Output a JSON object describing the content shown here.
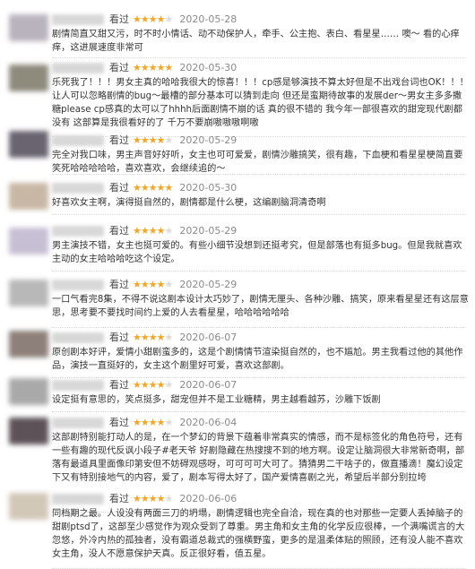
{
  "status_label": "看过",
  "reviews": [
    {
      "rating": 4,
      "time": "2020-05-28",
      "avatar_color": "#b9b3bd",
      "text": "剧情简直又甜又污，时不时小情话、动不动保护人，牵手、公主抱、表白、看星星…… 噢～ 看的心痒痒，这进展速度非常可"
    },
    {
      "rating": 5,
      "time": "2020-05-30",
      "avatar_color": "#8e8a7c",
      "text": "乐死我了！！！男女主真的哈哈我很大的惊喜！！！cp感是够演技不算太好但是不出戏台词也OK！！！让人可以忽略剧情的bug～最槽的部分基本可以猜到走向 但还是蛮期待故事的发展der～男女主多多撒糖please cp感真的太可以了hhhh后面剧情不崩的话 真的很不错的 我今年一部很喜欢的甜宠现代剧都没有 这部算是我很看好的了 千万不要崩嗷嗷嗷啊嗷"
    },
    {
      "rating": 4,
      "time": "2020-05-29",
      "avatar_color": "#6a6470",
      "text": "完全对我口味，男主声音好好听，女主也可可爱爱，剧情沙雕搞笑，很有趣，下血梗和看星星梗简直要笑死哈哈哈哈哈，喜欢喜欢，会继续追的～"
    },
    {
      "rating": 5,
      "time": "2020-05-30",
      "avatar_color": "#c8b7a5",
      "text": "好喜欢女主啊，演得挺自然的，剧情都是什么梗，这编剧脑洞清奇啊"
    },
    {
      "rating": 4,
      "time": "2020-05-29",
      "avatar_color": "#c7bfd3",
      "text": "男主演技不错，女主也挺可爱的。有些小细节没想到还挺考究，但是部落也有挺多bug。但是我就喜欢主动的女主哈哈哈吃这个设定。"
    },
    {
      "rating": 4,
      "time": "2020-05-29",
      "avatar_color": "#b8b8b8",
      "text": "一口气看完8集，不得不说这剧本设计太巧妙了，剧情无厘头、各种沙雕、搞笑，原来看星星还有这层意思，思考要不要找时间约上爱的人去看星星，哈哈哈哈哈哈"
    },
    {
      "rating": 4,
      "time": "2020-06-07",
      "avatar_color": "#8d7f79",
      "text": "原创剧本好评，爱情小甜剧蛮多的，这是个剧情情节渲染挺自然的，也不尴尬。男主我看过他的其他作品，演技一直挺好的，女主这个剧里好可爱，喜欢这部剧。"
    },
    {
      "rating": 4,
      "time": "2020-06-07",
      "avatar_color": "#a9a9a9",
      "text": "设定挺有意思的，笑点挺多，甜宠但并不是工业糖精，男主越看越苏，沙雕下饭剧"
    },
    {
      "rating": 4,
      "time": "2020-06-04",
      "avatar_color": "#5c5257",
      "text": "这部剧特别能打动人的是，在一个梦幻的背景下蕴着非常真实的情感，而不是标签化的角色符号，还有一些有趣的现代反讽小段子#老天爷 好剧隐藏在热搜搜不到的地方啊。设定让脑洞很大非常新奇啊，部落有最道具里面像印第安但不妨碍观感呀，可可可可大可了。猜猜男二干啥子的，做直播滴！魔幻设定下又有特别接地气的内容，爱了，剧本写得太好了，国产爱情喜剧之光，希望后半部分别拉垮"
    },
    {
      "rating": 4,
      "time": "2020-06-06",
      "avatar_color": "#d2c8b8",
      "text": "同档期之最。人设没有两面三刀的坍塌，剧情逻辑也完全自洽，现在真的也对那些一定要人丢掉脑子的甜剧ptsd了，这部至少感觉作为观众受到了尊重。男主角和女主角的化学反应很棒，一个满嘴谎言的大忽悠，外冷内热的孤独者，没有霸道总裁式的强横野蛮，更多的是温柔体贴的照顾，还有没人能不喜欢女主角，没人不愿意保护天真。反正很好看，值五星。"
    }
  ]
}
